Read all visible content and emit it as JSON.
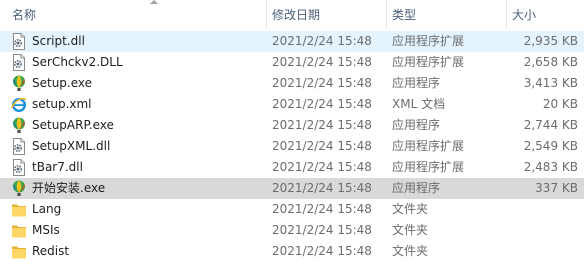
{
  "columns": {
    "name": "名称",
    "date": "修改日期",
    "type": "类型",
    "size": "大小"
  },
  "files": [
    {
      "name": "Script.dll",
      "date": "2021/2/24 15:48",
      "type": "应用程序扩展",
      "size": "2,935 KB",
      "icon": "dll-gear-icon",
      "state": "hover"
    },
    {
      "name": "SerChckv2.DLL",
      "date": "2021/2/24 15:48",
      "type": "应用程序扩展",
      "size": "2,658 KB",
      "icon": "dll-gear-icon",
      "state": "normal"
    },
    {
      "name": "Setup.exe",
      "date": "2021/2/24 15:48",
      "type": "应用程序",
      "size": "3,413 KB",
      "icon": "coreldraw-balloon-icon",
      "state": "normal"
    },
    {
      "name": "setup.xml",
      "date": "2021/2/24 15:48",
      "type": "XML 文档",
      "size": "20 KB",
      "icon": "ie-xml-icon",
      "state": "normal"
    },
    {
      "name": "SetupARP.exe",
      "date": "2021/2/24 15:48",
      "type": "应用程序",
      "size": "2,744 KB",
      "icon": "coreldraw-balloon-icon",
      "state": "normal"
    },
    {
      "name": "SetupXML.dll",
      "date": "2021/2/24 15:48",
      "type": "应用程序扩展",
      "size": "2,549 KB",
      "icon": "dll-gear-icon",
      "state": "normal"
    },
    {
      "name": "tBar7.dll",
      "date": "2021/2/24 15:48",
      "type": "应用程序扩展",
      "size": "2,483 KB",
      "icon": "dll-gear-icon",
      "state": "normal"
    },
    {
      "name": "开始安装.exe",
      "date": "2021/2/24 15:48",
      "type": "应用程序",
      "size": "337 KB",
      "icon": "coreldraw-balloon-icon",
      "state": "selected"
    },
    {
      "name": "Lang",
      "date": "2021/2/24 15:48",
      "type": "文件夹",
      "size": "",
      "icon": "folder-icon",
      "state": "normal"
    },
    {
      "name": "MSIs",
      "date": "2021/2/24 15:48",
      "type": "文件夹",
      "size": "",
      "icon": "folder-icon",
      "state": "normal"
    },
    {
      "name": "Redist",
      "date": "2021/2/24 15:48",
      "type": "文件夹",
      "size": "",
      "icon": "folder-icon",
      "state": "normal"
    }
  ],
  "colors": {
    "header_text": "#4c607a",
    "hover_row": "#e5f3ff",
    "selected_row": "#d9d9d9",
    "folder": "#ffd766"
  }
}
